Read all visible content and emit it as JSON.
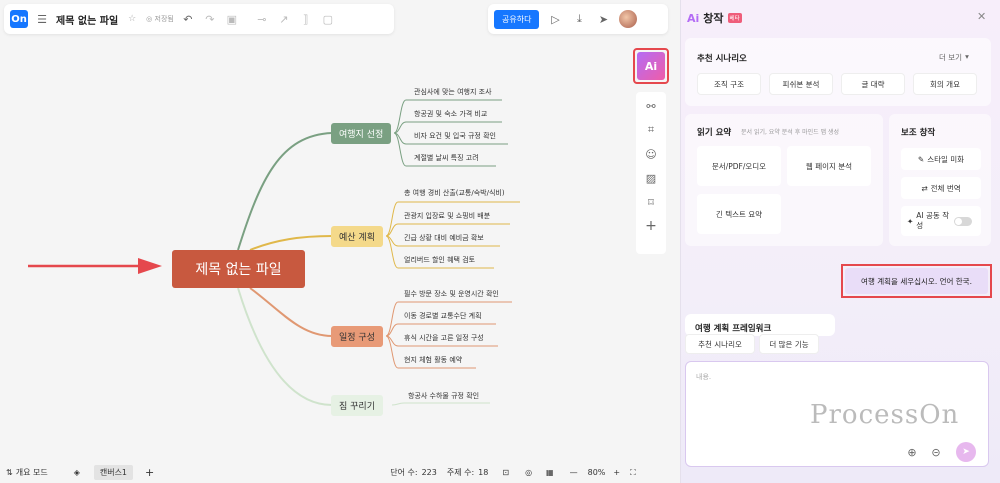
{
  "topbar": {
    "logo": "On",
    "title": "제목 없는 파일",
    "saved_status": "저장됨",
    "share_label": "공유하다"
  },
  "canvas": {
    "root": "제목 없는 파일",
    "branches": [
      {
        "label": "여행지 선정",
        "color": "#6b8f71",
        "fill": "#7aa082",
        "leaves": [
          "관심사에 맞는 여행지 조사",
          "항공권 및 숙소 가격 비교",
          "비자 요건 및 입국 규정 확인",
          "계절별 날씨 특징 고려"
        ]
      },
      {
        "label": "예산 계획",
        "color": "#e0b84a",
        "fill": "#f4d98a",
        "leaves": [
          "총 여행 경비 산출(교통/숙박/식비)",
          "관광지 입장료 및 쇼핑비 배분",
          "긴급 상황 대비 예비금 확보",
          "얼리버드 할인 혜택 검토"
        ]
      },
      {
        "label": "일정 구성",
        "color": "#d98259",
        "fill": "#e89a77",
        "leaves": [
          "필수 방문 장소 및 운영시간 확인",
          "이동 경로별 교통수단 계획",
          "휴식 시간을 고른 일정 구성",
          "현지 체험 활동 예약"
        ]
      },
      {
        "label": "짐 꾸리기",
        "color": "#b6d2b4",
        "fill": "#e6f1e4",
        "leaves": [
          "항공사 수하물 규정 확인"
        ]
      }
    ]
  },
  "bottombar": {
    "outline_mode": "개요 모드",
    "canvas_tab": "캔버스1",
    "word_count_label": "단어 수:",
    "word_count": "223",
    "topic_count_label": "주제 수:",
    "topic_count": "18",
    "zoom": "80%"
  },
  "panel": {
    "title": "창작",
    "badge": "베타",
    "recommend": {
      "heading": "추천 시나리오",
      "more": "더 보기",
      "items": [
        "조직 구조",
        "피쉬본 분석",
        "글 대략",
        "회의 개요"
      ]
    },
    "read": {
      "heading": "읽기 요약",
      "desc": "문서 읽기, 요약 분석 후 마인드 맵 생성",
      "items": [
        "문서/PDF/오디오",
        "웹 페이지 분석",
        "긴 텍스트 요약"
      ]
    },
    "assist": {
      "heading": "보조 창작",
      "items": [
        "스타일 미화",
        "전체 번역"
      ],
      "toggle_label": "AI 공동 작성"
    },
    "user_message": "여행 계획을 세우십시오. 언어 한국.",
    "assistant_preview": "여행 계획 프레임워크",
    "quick": [
      "추천 시나리오",
      "더 많은 기능"
    ],
    "input_placeholder": "내용.",
    "watermark": "ProcessOn"
  }
}
